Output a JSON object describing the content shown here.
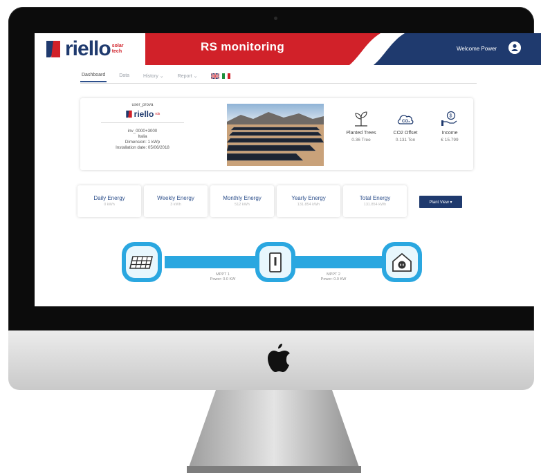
{
  "header": {
    "brand": "riello",
    "brand_sub": "solar tech",
    "title": "RS monitoring",
    "welcome": "Welcome Power",
    "colors": {
      "red": "#d12129",
      "navy": "#1f3a6e"
    }
  },
  "nav": {
    "tabs": [
      {
        "label": "Dashboard",
        "active": true
      },
      {
        "label": "Data"
      },
      {
        "label": "History ⌄"
      },
      {
        "label": "Report ⌄"
      }
    ],
    "flags": [
      "uk-flag",
      "italy-flag"
    ]
  },
  "plant": {
    "user": "user_prova",
    "brand": "riello",
    "brand_sub": "rds",
    "id": "inv_0000+3000",
    "country": "Italia",
    "dimension": "Dimension: 1 kWp",
    "installation_date": "Installation date: 05/06/2018"
  },
  "metrics": [
    {
      "label": "Planted Trees",
      "value": "0.36 Tree",
      "icon": "sprout-icon"
    },
    {
      "label": "CO2 Offset",
      "value": "0.131 Ton",
      "icon": "co2-cloud-icon"
    },
    {
      "label": "Income",
      "value": "€ 15.799",
      "icon": "coin-hand-icon"
    }
  ],
  "energy": [
    {
      "label": "Daily Energy",
      "value": "0 kWh"
    },
    {
      "label": "Weekly Energy",
      "value": "3 kWh"
    },
    {
      "label": "Monthly Energy",
      "value": "512 kWh"
    },
    {
      "label": "Yearly Energy",
      "value": "131.854 kWh"
    },
    {
      "label": "Total Energy",
      "value": "131.854 kWh"
    }
  ],
  "plant_view_label": "Plant View ▾",
  "flow": {
    "nodes": [
      "solar-panel-icon",
      "inverter-icon",
      "house-plug-icon"
    ],
    "mppt": [
      {
        "name": "MPPT 1",
        "power": "Power: 0.0 KW"
      },
      {
        "name": "MPPT 2",
        "power": "Power: 0.0 KW"
      }
    ],
    "accent": "#2aa7e0"
  }
}
